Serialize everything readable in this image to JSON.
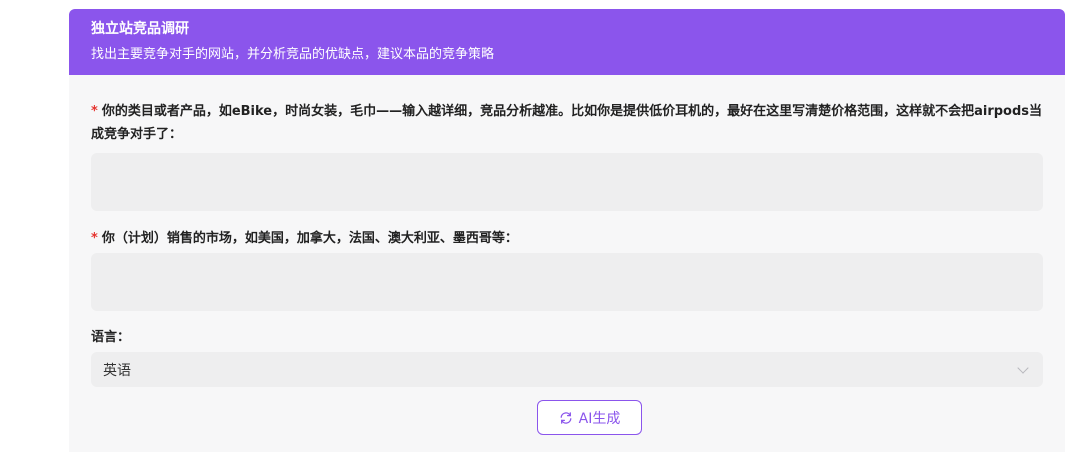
{
  "header": {
    "title": "独立站竞品调研",
    "subtitle": "找出主要竞争对手的网站，并分析竞品的优缺点，建议本品的竞争策略"
  },
  "form": {
    "required_mark": "*",
    "q1": {
      "label": "你的类目或者产品，如eBike，时尚女装，毛巾——输入越详细，竞品分析越准。比如你是提供低价耳机的，最好在这里写清楚价格范围，这样就不会把airpods当成竞争对手了：",
      "value": ""
    },
    "q2": {
      "label": "你（计划）销售的市场，如美国，加拿大，法国、澳大利亚、墨西哥等：",
      "value": ""
    },
    "language": {
      "label": "语言：",
      "selected": "英语"
    },
    "generate_button": {
      "label": "AI生成",
      "icon": "refresh-icon"
    }
  },
  "colors": {
    "accent": "#8b55ec",
    "required": "#e5342f",
    "card_bg": "#f7f7f8",
    "input_bg": "#eeeeef"
  }
}
